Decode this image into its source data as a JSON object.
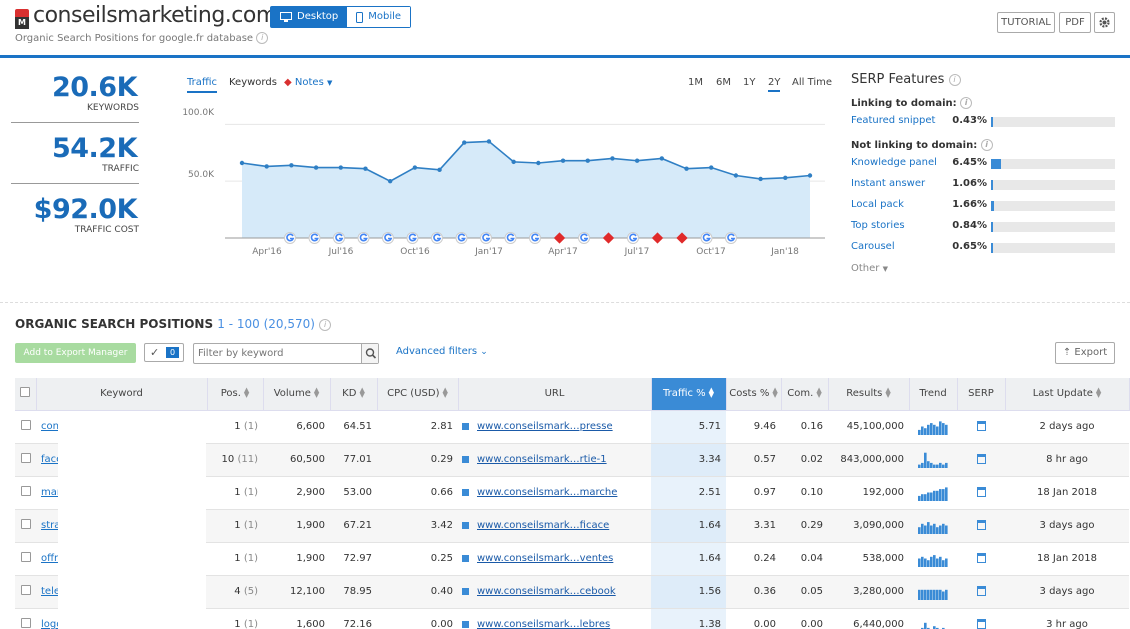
{
  "header": {
    "domain": "conseilsmarketing.com",
    "subtitle": "Organic Search Positions for google.fr database",
    "desktop_label": "Desktop",
    "mobile_label": "Mobile",
    "tutorial_label": "TUTORIAL",
    "pdf_label": "PDF"
  },
  "kpis": [
    {
      "value": "20.6K",
      "label": "KEYWORDS"
    },
    {
      "value": "54.2K",
      "label": "TRAFFIC"
    },
    {
      "value": "$92.0K",
      "label": "TRAFFIC COST"
    }
  ],
  "chart_tabs": {
    "traffic": "Traffic",
    "keywords": "Keywords",
    "notes": "Notes"
  },
  "time_filters": [
    "1M",
    "6M",
    "1Y",
    "2Y",
    "All Time"
  ],
  "chart_data": {
    "type": "area",
    "x": [
      "Feb'16",
      "Mar'16",
      "Apr'16",
      "May'16",
      "Jun'16",
      "Jul'16",
      "Aug'16",
      "Sep'16",
      "Oct'16",
      "Nov'16",
      "Dec'16",
      "Jan'17",
      "Feb'17",
      "Mar'17",
      "Apr'17",
      "May'17",
      "Jun'17",
      "Jul'17",
      "Aug'17",
      "Sep'17",
      "Oct'17",
      "Nov'17",
      "Dec'17",
      "Jan'18",
      "Feb'18"
    ],
    "values": [
      66,
      63,
      64,
      62,
      62,
      61,
      50,
      62,
      60,
      84,
      85,
      67,
      66,
      68,
      68,
      70,
      68,
      70,
      61,
      62,
      55,
      52,
      53,
      55
    ],
    "ytick_labels": [
      "100.0K",
      "50.0K"
    ],
    "yticks": [
      100,
      50
    ],
    "ylim": [
      0,
      110
    ],
    "xtick_labels": [
      "Apr'16",
      "Jul'16",
      "Oct'16",
      "Jan'17",
      "Apr'17",
      "Jul'17",
      "Oct'17",
      "Jan'18"
    ],
    "markers": [
      "g",
      "g",
      "g",
      "g",
      "g",
      "g",
      "g",
      "g",
      "g",
      "g",
      "g",
      "n",
      "g",
      "n",
      "g",
      "n",
      "n",
      "g",
      "g"
    ]
  },
  "serp": {
    "title": "SERP Features",
    "linking_title": "Linking to domain:",
    "not_linking_title": "Not linking to domain:",
    "other": "Other",
    "linking": [
      {
        "name": "Featured snippet",
        "pct": "0.43%",
        "frac": 0.0043
      }
    ],
    "not_linking": [
      {
        "name": "Knowledge panel",
        "pct": "6.45%",
        "frac": 0.0645
      },
      {
        "name": "Instant answer",
        "pct": "1.06%",
        "frac": 0.0106
      },
      {
        "name": "Local pack",
        "pct": "1.66%",
        "frac": 0.0166
      },
      {
        "name": "Top stories",
        "pct": "0.84%",
        "frac": 0.0084
      },
      {
        "name": "Carousel",
        "pct": "0.65%",
        "frac": 0.0065
      }
    ]
  },
  "positions": {
    "title": "ORGANIC SEARCH POSITIONS",
    "range": "1 - 100 (20,570)",
    "add_label": "Add to Export Manager",
    "check_count": "0",
    "filter_placeholder": "Filter by keyword",
    "advanced_label": "Advanced filters",
    "export_label": "Export"
  },
  "table": {
    "headers": [
      "Keyword",
      "Pos.",
      "Volume",
      "KD",
      "CPC (USD)",
      "URL",
      "Traffic %",
      "Costs %",
      "Com.",
      "Results",
      "Trend",
      "SERP",
      "Last Update"
    ],
    "rows": [
      {
        "kw": "con",
        "pos": "1",
        "prev": "(1)",
        "vol": "6,600",
        "kd": "64.51",
        "cpc": "2.81",
        "url": "www.conseilsmark…presse",
        "traf": "5.71",
        "cost": "9.46",
        "com": "0.16",
        "res": "45,100,000",
        "upd": "2 days ago"
      },
      {
        "kw": "face",
        "pos": "10",
        "prev": "(11)",
        "vol": "60,500",
        "kd": "77.01",
        "cpc": "0.29",
        "url": "www.conseilsmark…rtie-1",
        "traf": "3.34",
        "cost": "0.57",
        "com": "0.02",
        "res": "843,000,000",
        "upd": "8 hr ago"
      },
      {
        "kw": "mar",
        "pos": "1",
        "prev": "(1)",
        "vol": "2,900",
        "kd": "53.00",
        "cpc": "0.66",
        "url": "www.conseilsmark…marche",
        "traf": "2.51",
        "cost": "0.97",
        "com": "0.10",
        "res": "192,000",
        "upd": "18 Jan 2018"
      },
      {
        "kw": "stra",
        "pos": "1",
        "prev": "(1)",
        "vol": "1,900",
        "kd": "67.21",
        "cpc": "3.42",
        "url": "www.conseilsmark…ficace",
        "traf": "1.64",
        "cost": "3.31",
        "com": "0.29",
        "res": "3,090,000",
        "upd": "3 days ago"
      },
      {
        "kw": "offr",
        "pos": "1",
        "prev": "(1)",
        "vol": "1,900",
        "kd": "72.97",
        "cpc": "0.25",
        "url": "www.conseilsmark…ventes",
        "traf": "1.64",
        "cost": "0.24",
        "com": "0.04",
        "res": "538,000",
        "upd": "18 Jan 2018"
      },
      {
        "kw": "tele",
        "pos": "4",
        "prev": "(5)",
        "vol": "12,100",
        "kd": "78.95",
        "cpc": "0.40",
        "url": "www.conseilsmark…cebook",
        "traf": "1.56",
        "cost": "0.36",
        "com": "0.05",
        "res": "3,280,000",
        "upd": "3 days ago"
      },
      {
        "kw": "logo",
        "pos": "1",
        "prev": "(1)",
        "vol": "1,600",
        "kd": "72.16",
        "cpc": "0.00",
        "url": "www.conseilsmark…lebres",
        "traf": "1.38",
        "cost": "0.00",
        "com": "0.00",
        "res": "6,440,000",
        "upd": "3 hr ago"
      }
    ]
  }
}
